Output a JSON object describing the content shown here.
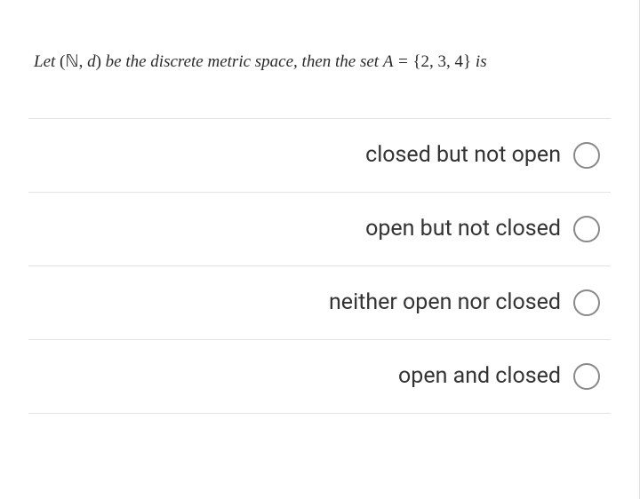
{
  "question": {
    "prefix": "Let ",
    "space_open": "(",
    "space_sym": "ℕ",
    "space_sep": ", ",
    "space_var": "d",
    "space_close": ") ",
    "mid": "be the discrete metric space, then the set ",
    "set_lhs": "A = ",
    "set_open": "{",
    "set_vals": "2, 3, 4",
    "set_close": "} ",
    "suffix": "is"
  },
  "options": [
    {
      "label": "closed but not open"
    },
    {
      "label": "open but not closed"
    },
    {
      "label": "neither open nor closed"
    },
    {
      "label": "open and closed"
    }
  ]
}
